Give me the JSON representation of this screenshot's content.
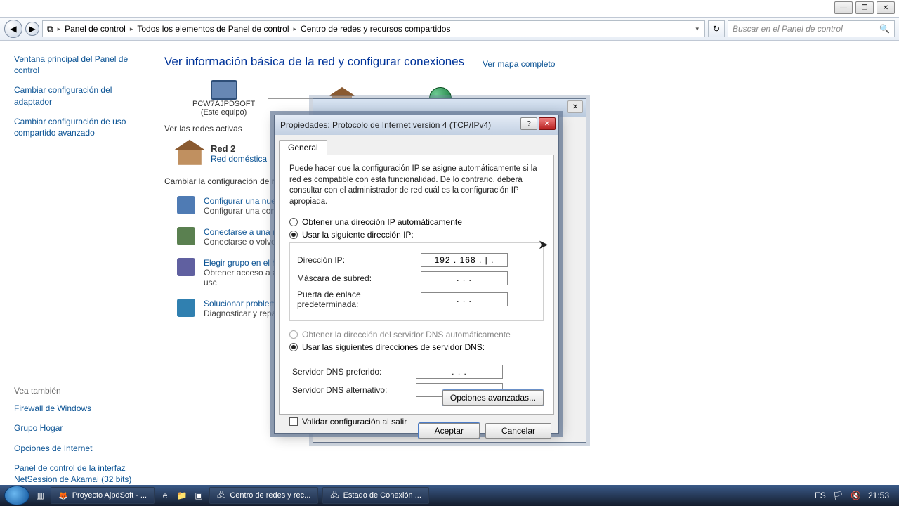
{
  "window_controls": {
    "min": "—",
    "max": "❐",
    "close": "✕"
  },
  "breadcrumb": {
    "root_icon": "control-panel-icon",
    "items": [
      "Panel de control",
      "Todos los elementos de Panel de control",
      "Centro de redes y recursos compartidos"
    ]
  },
  "search": {
    "placeholder": "Buscar en el Panel de control"
  },
  "sidebar": {
    "links": [
      "Ventana principal del Panel de control",
      "Cambiar configuración del adaptador",
      "Cambiar configuración de uso compartido avanzado"
    ],
    "see_also_header": "Vea también",
    "see_also": [
      "Firewall de Windows",
      "Grupo Hogar",
      "Opciones de Internet",
      "Panel de control de la interfaz NetSession de Akamai (32 bits)"
    ]
  },
  "content": {
    "title": "Ver información básica de la red y configurar conexiones",
    "map_link": "Ver mapa completo",
    "node1": {
      "name": "PCW7AJPDSOFT",
      "sub": "(Este equipo)"
    },
    "active_nets_label": "Ver las redes activas",
    "net": {
      "name": "Red 2",
      "type": "Red doméstica"
    },
    "change_hdr": "Cambiar la configuración de red",
    "tasks": [
      {
        "link": "Configurar una nueva",
        "desc": "Configurar una cone\nconfigurar un enruta"
      },
      {
        "link": "Conectarse a una red",
        "desc": "Conectarse o volver a\no VPN."
      },
      {
        "link": "Elegir grupo en el ho",
        "desc": "Obtener acceso a arc\nconfiguración de usc"
      },
      {
        "link": "Solucionar problema",
        "desc": "Diagnosticar y repara"
      }
    ]
  },
  "dialog": {
    "title": "Propiedades: Protocolo de Internet versión 4 (TCP/IPv4)",
    "tab": "General",
    "info": "Puede hacer que la configuración IP se asigne automáticamente si la red es compatible con esta funcionalidad. De lo contrario, deberá consultar con el administrador de red cuál es la configuración IP apropiada.",
    "radio_auto_ip": "Obtener una dirección IP automáticamente",
    "radio_manual_ip": "Usar la siguiente dirección IP:",
    "ip_label": "Dirección IP:",
    "ip_value": "192 . 168 .    |   .",
    "mask_label": "Máscara de subred:",
    "mask_value": ".       .       .",
    "gw_label": "Puerta de enlace predeterminada:",
    "gw_value": ".       .       .",
    "radio_auto_dns": "Obtener la dirección del servidor DNS automáticamente",
    "radio_manual_dns": "Usar las siguientes direcciones de servidor DNS:",
    "dns1_label": "Servidor DNS preferido:",
    "dns1_value": ".       .       .",
    "dns2_label": "Servidor DNS alternativo:",
    "dns2_value": ".       .       .",
    "validate_label": "Validar configuración al salir",
    "advanced_btn": "Opciones avanzadas...",
    "ok_btn": "Aceptar",
    "cancel_btn": "Cancelar"
  },
  "taskbar": {
    "items": [
      "Proyecto AjpdSoft - ...",
      "Centro de redes y rec...",
      "Estado de Conexión ..."
    ],
    "lang": "ES",
    "time": "21:53"
  }
}
